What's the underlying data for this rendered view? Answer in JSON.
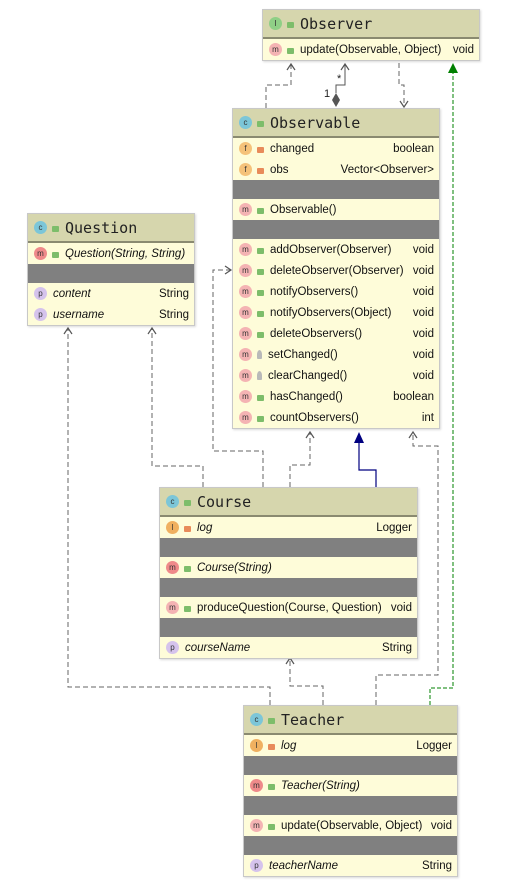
{
  "colors": {
    "header": "#d6d6ad",
    "body": "#fefcd9",
    "separator": "#808080",
    "realization_edge": "#008000",
    "inheritance_edge": "#000080",
    "dependency_edge": "#555555"
  },
  "classes": [
    {
      "id": "observer",
      "kind": "interface",
      "badge": "I",
      "name": "Observer",
      "sections": [
        [
          {
            "icon": "method",
            "vis": "public",
            "name": "update(Observable, Object)",
            "type": "void"
          }
        ]
      ]
    },
    {
      "id": "observable",
      "kind": "class",
      "badge": "c",
      "name": "Observable",
      "sections": [
        [
          {
            "icon": "field",
            "vis": "private",
            "name": "changed",
            "type": "boolean"
          },
          {
            "icon": "field",
            "vis": "private",
            "name": "obs",
            "type": "Vector<Observer>"
          }
        ],
        [
          {
            "icon": "method",
            "vis": "public",
            "name": "Observable()",
            "type": ""
          }
        ],
        [
          {
            "icon": "method",
            "vis": "public",
            "name": "addObserver(Observer)",
            "type": "void"
          },
          {
            "icon": "method",
            "vis": "public",
            "name": "deleteObserver(Observer)",
            "type": "void"
          },
          {
            "icon": "method",
            "vis": "public",
            "name": "notifyObservers()",
            "type": "void"
          },
          {
            "icon": "method",
            "vis": "public",
            "name": "notifyObservers(Object)",
            "type": "void"
          },
          {
            "icon": "method",
            "vis": "public",
            "name": "deleteObservers()",
            "type": "void"
          },
          {
            "icon": "method",
            "vis": "protected",
            "name": "setChanged()",
            "type": "void"
          },
          {
            "icon": "method",
            "vis": "protected",
            "name": "clearChanged()",
            "type": "void"
          },
          {
            "icon": "method",
            "vis": "public",
            "name": "hasChanged()",
            "type": "boolean"
          },
          {
            "icon": "method",
            "vis": "public",
            "name": "countObservers()",
            "type": "int"
          }
        ]
      ]
    },
    {
      "id": "question",
      "kind": "class",
      "badge": "c",
      "name": "Question",
      "sections": [
        [
          {
            "icon": "constructor",
            "vis": "public",
            "name": "Question(String, String)",
            "type": "",
            "italic": true
          }
        ],
        [
          {
            "icon": "property",
            "vis": "",
            "name": "content",
            "type": "String",
            "italic": true
          },
          {
            "icon": "property",
            "vis": "",
            "name": "username",
            "type": "String",
            "italic": true
          }
        ]
      ]
    },
    {
      "id": "course",
      "kind": "class",
      "badge": "c",
      "name": "Course",
      "sections": [
        [
          {
            "icon": "logger",
            "vis": "private",
            "name": "log",
            "type": "Logger",
            "italic": true
          }
        ],
        [
          {
            "icon": "constructor",
            "vis": "public",
            "name": "Course(String)",
            "type": "",
            "italic": true
          }
        ],
        [
          {
            "icon": "method",
            "vis": "public",
            "name": "produceQuestion(Course, Question)",
            "type": "void"
          }
        ],
        [
          {
            "icon": "property",
            "vis": "",
            "name": "courseName",
            "type": "String",
            "italic": true
          }
        ]
      ]
    },
    {
      "id": "teacher",
      "kind": "class",
      "badge": "c",
      "name": "Teacher",
      "sections": [
        [
          {
            "icon": "logger",
            "vis": "private",
            "name": "log",
            "type": "Logger",
            "italic": true
          }
        ],
        [
          {
            "icon": "constructor",
            "vis": "public",
            "name": "Teacher(String)",
            "type": "",
            "italic": true
          }
        ],
        [
          {
            "icon": "method",
            "vis": "public",
            "name": "update(Observable, Object)",
            "type": "void"
          }
        ],
        [
          {
            "icon": "property",
            "vis": "",
            "name": "teacherName",
            "type": "String",
            "italic": true
          }
        ]
      ]
    }
  ],
  "edges": [
    {
      "from": "observable",
      "to": "observer",
      "type": "dependency"
    },
    {
      "from": "observable",
      "to": "observer",
      "type": "composition",
      "source_multiplicity": "1",
      "target_multiplicity": "*"
    },
    {
      "from": "observer",
      "to": "observable",
      "type": "dependency"
    },
    {
      "from": "teacher",
      "to": "observer",
      "type": "realization"
    },
    {
      "from": "course",
      "to": "question",
      "type": "dependency"
    },
    {
      "from": "course",
      "to": "observable",
      "type": "dependency"
    },
    {
      "from": "course",
      "to": "observable",
      "type": "dependency"
    },
    {
      "from": "course",
      "to": "observable",
      "type": "inheritance"
    },
    {
      "from": "teacher",
      "to": "observable",
      "type": "dependency"
    },
    {
      "from": "teacher",
      "to": "course",
      "type": "dependency"
    },
    {
      "from": "teacher",
      "to": "question",
      "type": "dependency"
    }
  ]
}
